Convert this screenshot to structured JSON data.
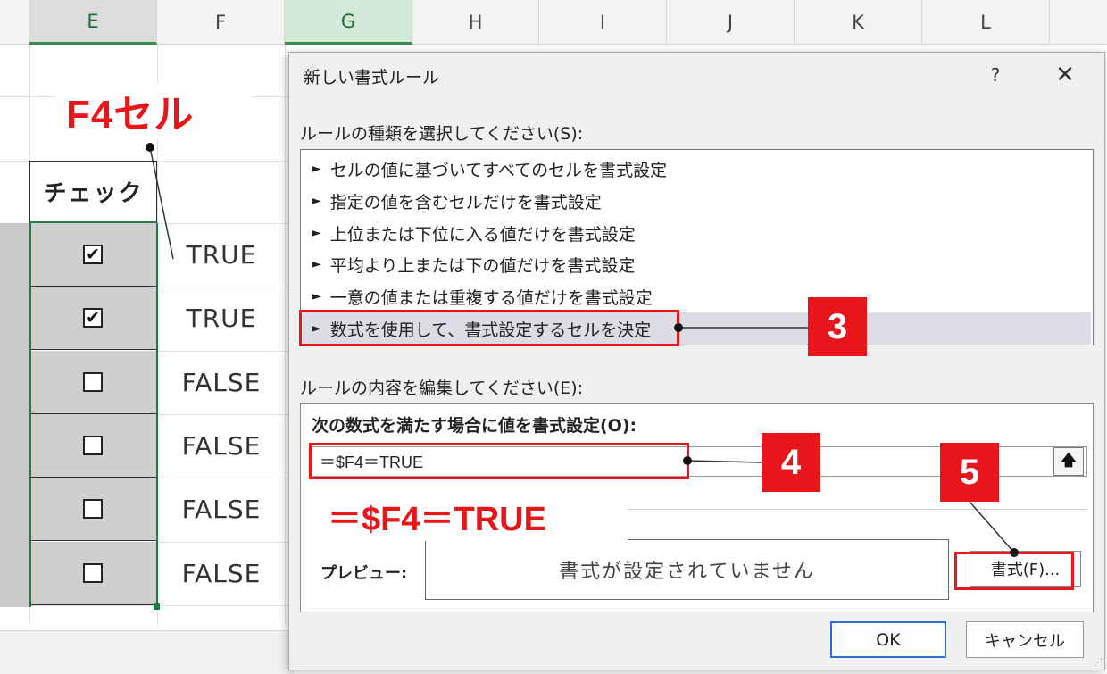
{
  "sheet": {
    "columns": [
      "E",
      "F",
      "G",
      "H",
      "I",
      "J",
      "K",
      "L"
    ],
    "header_cell": "チェック",
    "rows": [
      {
        "checked": true,
        "value": "TRUE"
      },
      {
        "checked": true,
        "value": "TRUE"
      },
      {
        "checked": false,
        "value": "FALSE"
      },
      {
        "checked": false,
        "value": "FALSE"
      },
      {
        "checked": false,
        "value": "FALSE"
      },
      {
        "checked": false,
        "value": "FALSE"
      }
    ],
    "check_glyph": "✔",
    "selection_color": "#1f7a44"
  },
  "annotations": {
    "cell_label": "F4セル",
    "formula_text": "＝$F4＝TRUE",
    "step_3": "3",
    "step_4": "4",
    "step_5": "5",
    "accent_color": "#e8151b"
  },
  "dialog": {
    "title": "新しい書式ルール",
    "help_label": "?",
    "close_label": "✕",
    "rule_type_label": "ルールの種類を選択してください(S):",
    "rule_types": [
      "セルの値に基づいてすべてのセルを書式設定",
      "指定の値を含むセルだけを書式設定",
      "上位または下位に入る値だけを書式設定",
      "平均より上または下の値だけを書式設定",
      "一意の値または重複する値だけを書式設定",
      "数式を使用して、書式設定するセルを決定"
    ],
    "selected_rule_index": 5,
    "rule_marker": "►",
    "edit_section_label": "ルールの内容を編集してください(E):",
    "formula_label": "次の数式を満たす場合に値を書式設定(O):",
    "formula_value": "＝$F4＝TRUE",
    "collapse_icon": "🡅",
    "preview_label": "プレビュー:",
    "preview_text": "書式が設定されていません",
    "format_button": "書式(F)...",
    "ok_button": "OK",
    "cancel_button": "キャンセル"
  }
}
